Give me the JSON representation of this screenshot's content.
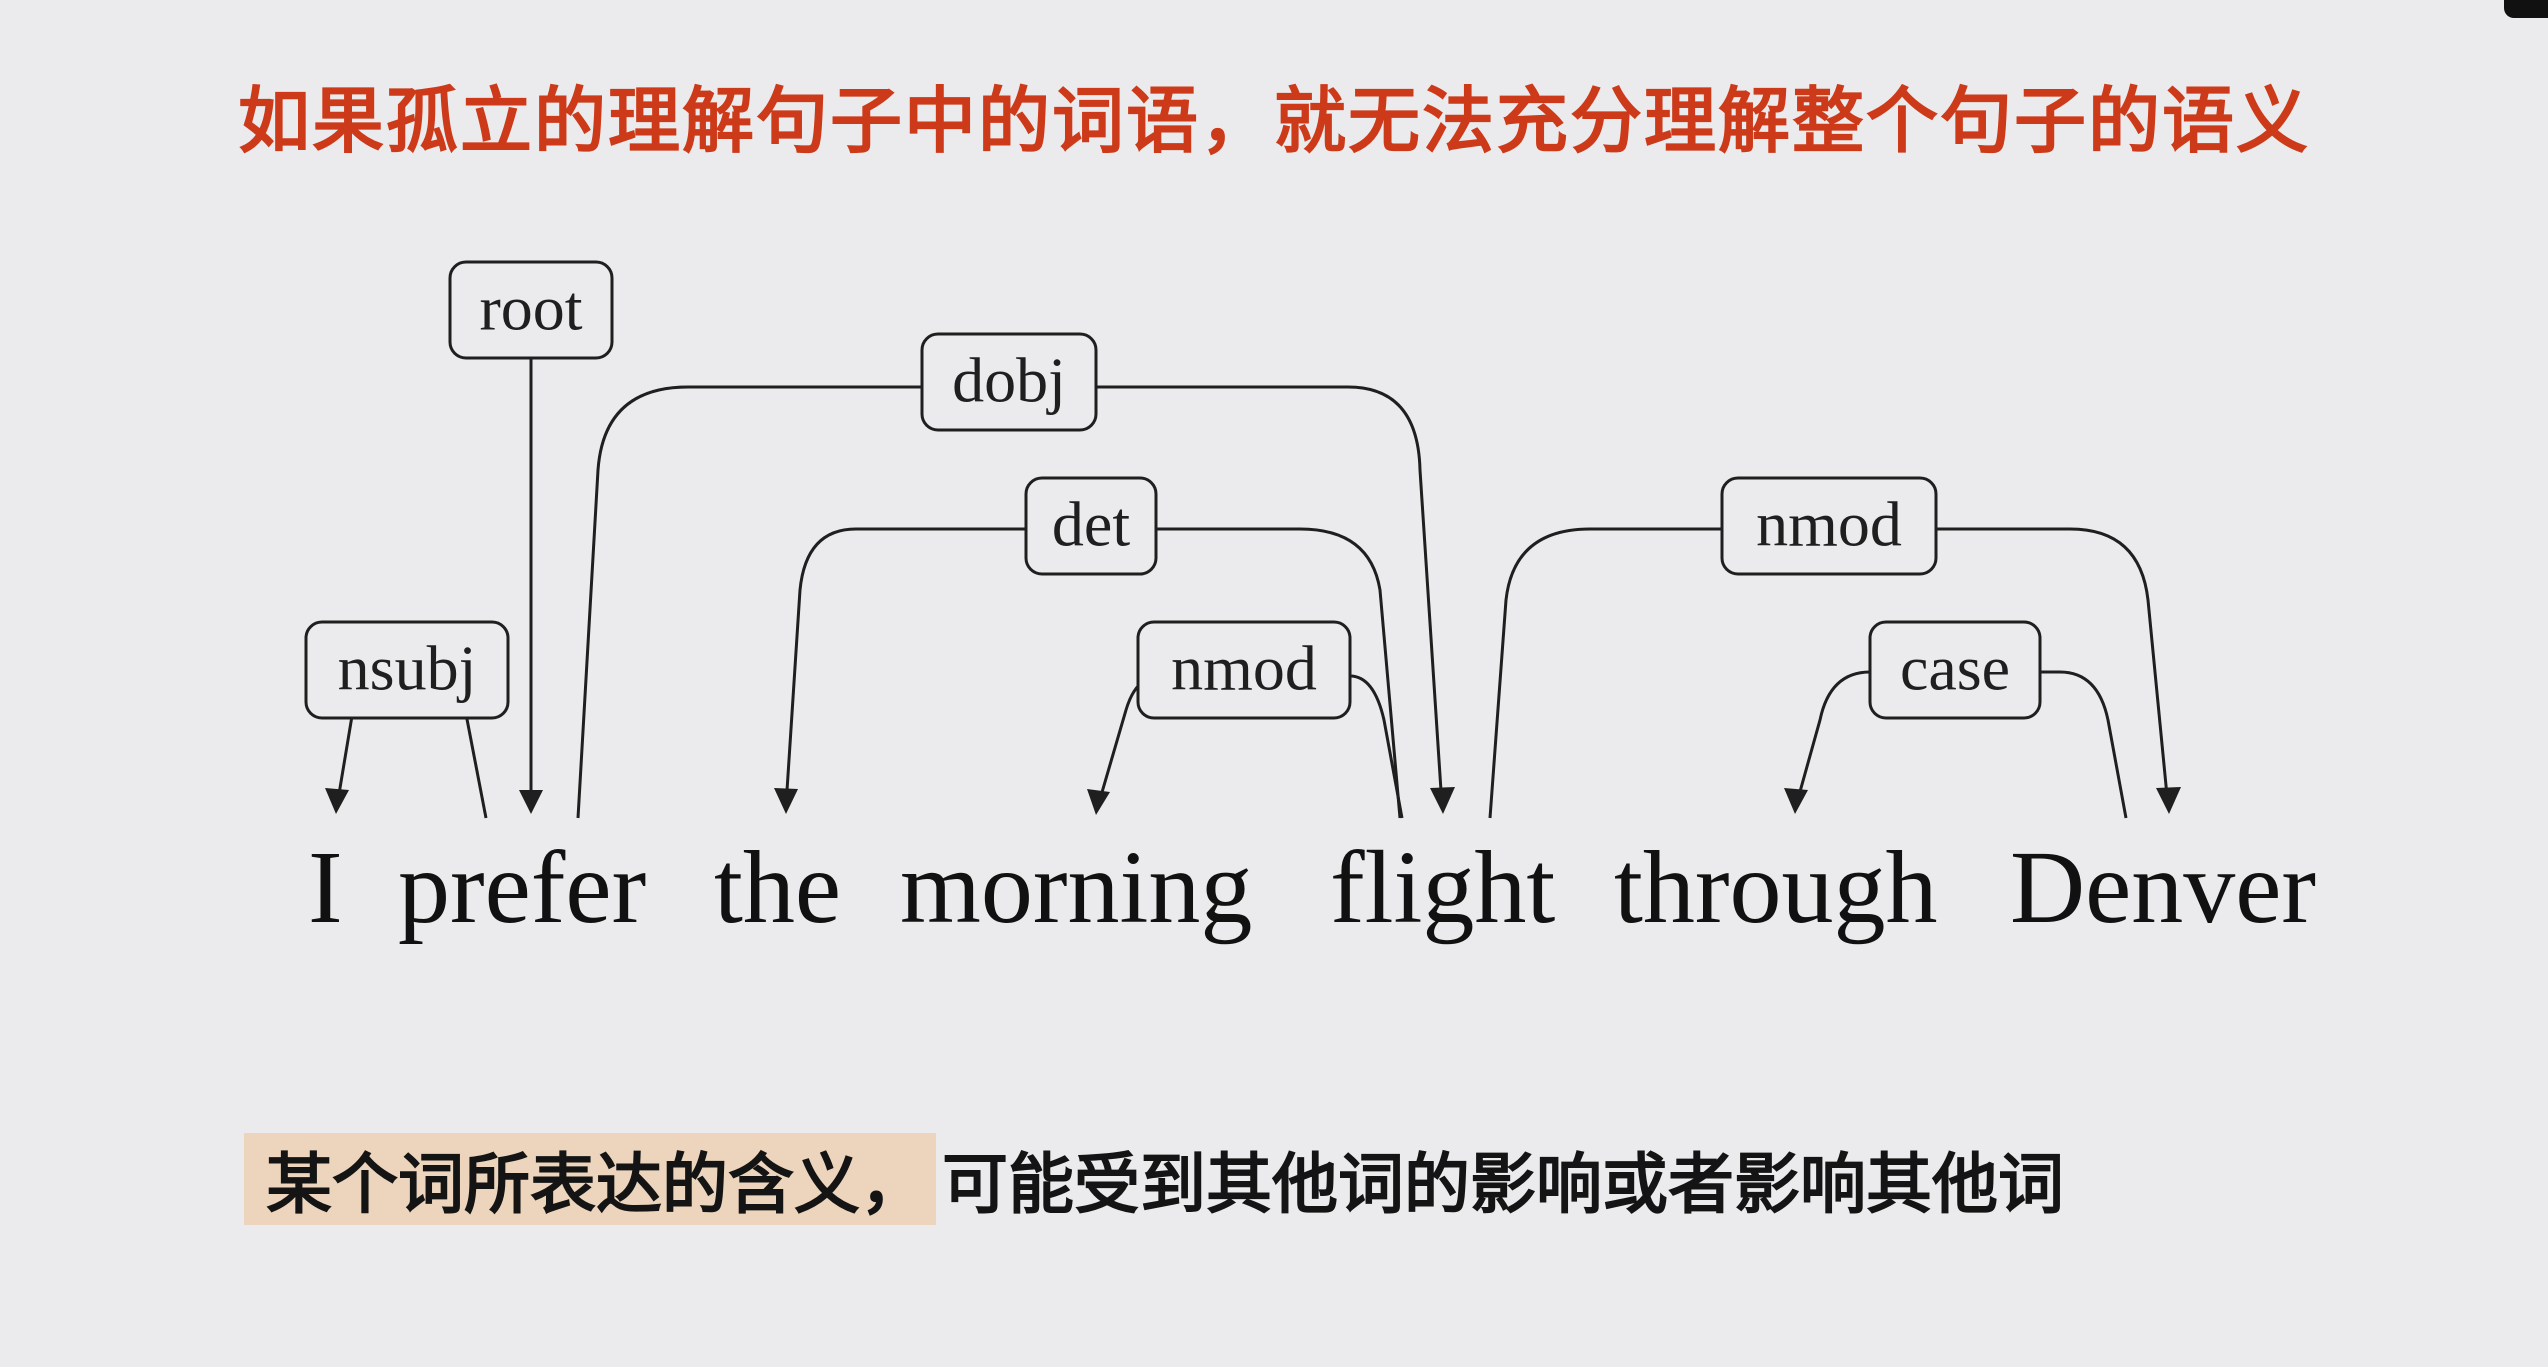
{
  "headline": "如果孤立的理解句子中的词语，就无法充分理解整个句子的语义",
  "sentence": {
    "words": [
      "I",
      "prefer",
      "the",
      "morning",
      "flight",
      "through",
      "Denver"
    ]
  },
  "relations": [
    {
      "label": "root"
    },
    {
      "label": "dobj"
    },
    {
      "label": "det"
    },
    {
      "label": "nmod"
    },
    {
      "label": "nsubj"
    },
    {
      "label": "nmod"
    },
    {
      "label": "case"
    }
  ],
  "caption": {
    "highlighted": "某个词所表达的含义，",
    "rest": "可能受到其他词的影响或者影响其他词"
  },
  "colors": {
    "background": "#ebebed",
    "headline": "#cc3a19",
    "highlight": "#ecd4bd",
    "ink": "#1f1f1f"
  }
}
